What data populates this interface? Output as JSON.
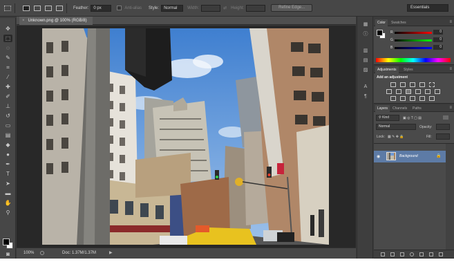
{
  "options_bar": {
    "feather_label": "Feather:",
    "feather_value": "0 px",
    "antialias_label": "Anti-alias",
    "style_label": "Style:",
    "style_value": "Normal",
    "width_label": "Width:",
    "height_label": "Height:",
    "refine_edge_label": "Refine Edge...",
    "workspace_value": "Essentials"
  },
  "document": {
    "tab_title": "Unknown.png @ 100% (RGB/8)",
    "close_symbol": "×"
  },
  "status_bar": {
    "zoom": "100%",
    "doc_info": "Doc: 1.37M/1.37M",
    "arrow": "▶"
  },
  "color_panel": {
    "tabs": [
      "Color",
      "Swatches"
    ],
    "rows": [
      {
        "label": "R",
        "value": "0"
      },
      {
        "label": "G",
        "value": "0"
      },
      {
        "label": "B",
        "value": "0"
      }
    ]
  },
  "adjustments_panel": {
    "tabs": [
      "Adjustments",
      "Styles"
    ],
    "title": "Add an adjustment"
  },
  "layers_panel": {
    "tabs": [
      "Layers",
      "Channels",
      "Paths"
    ],
    "kind_label": "Kind",
    "blend_mode": "Normal",
    "opacity_label": "Opacity:",
    "lock_label": "Lock:",
    "fill_label": "Fill:",
    "layers": [
      {
        "name": "Background",
        "visible": true,
        "locked": true
      }
    ]
  },
  "colors": {
    "foreground": "#000000",
    "background": "#ffffff",
    "layer_selected": "#5d7ba6"
  }
}
